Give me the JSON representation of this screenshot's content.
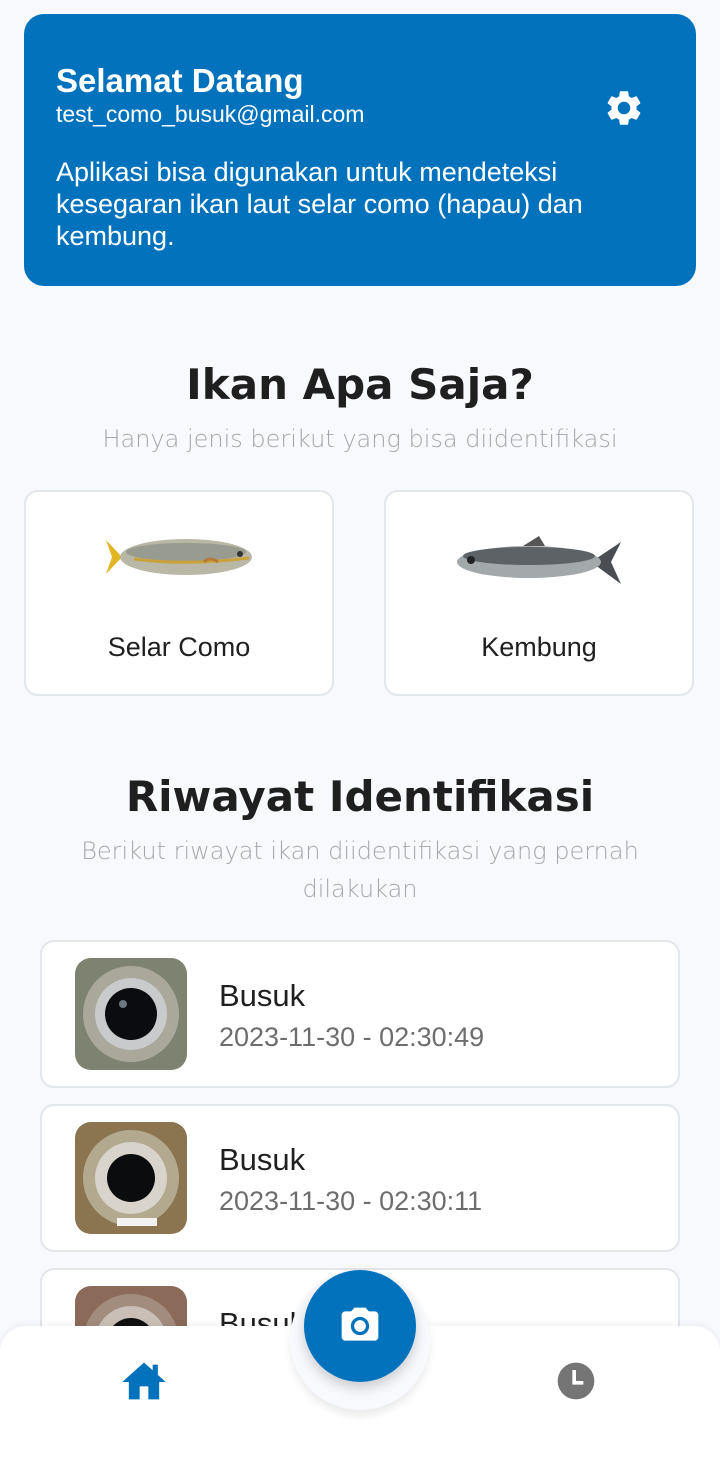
{
  "header": {
    "title": "Selamat Datang",
    "email": "test_como_busuk@gmail.com",
    "description": "Aplikasi bisa digunakan untuk mendeteksi kesegaran ikan laut selar como (hapau) dan kembung.",
    "settings_icon": "gear-icon",
    "background": "#0272BD"
  },
  "fish_section": {
    "title": "Ikan Apa Saja?",
    "subtitle": "Hanya jenis berikut yang bisa diidentifikasi",
    "items": [
      {
        "name": "Selar Como",
        "icon": "fish-selar-como-image"
      },
      {
        "name": "Kembung",
        "icon": "fish-kembung-image"
      }
    ]
  },
  "history_section": {
    "title": "Riwayat Identifikasi",
    "subtitle": "Berikut riwayat ikan diidentifikasi yang pernah dilakukan",
    "items": [
      {
        "status": "Busuk",
        "date": "2023-11-30 - 02:30:49"
      },
      {
        "status": "Busuk",
        "date": "2023-11-30 - 02:30:11"
      },
      {
        "status": "Busuk",
        "date": ""
      }
    ]
  },
  "bottom_nav": {
    "home_icon": "home-icon",
    "camera_icon": "camera-icon",
    "history_icon": "clock-icon",
    "active_color": "#0272BD",
    "inactive_color": "#757575"
  }
}
